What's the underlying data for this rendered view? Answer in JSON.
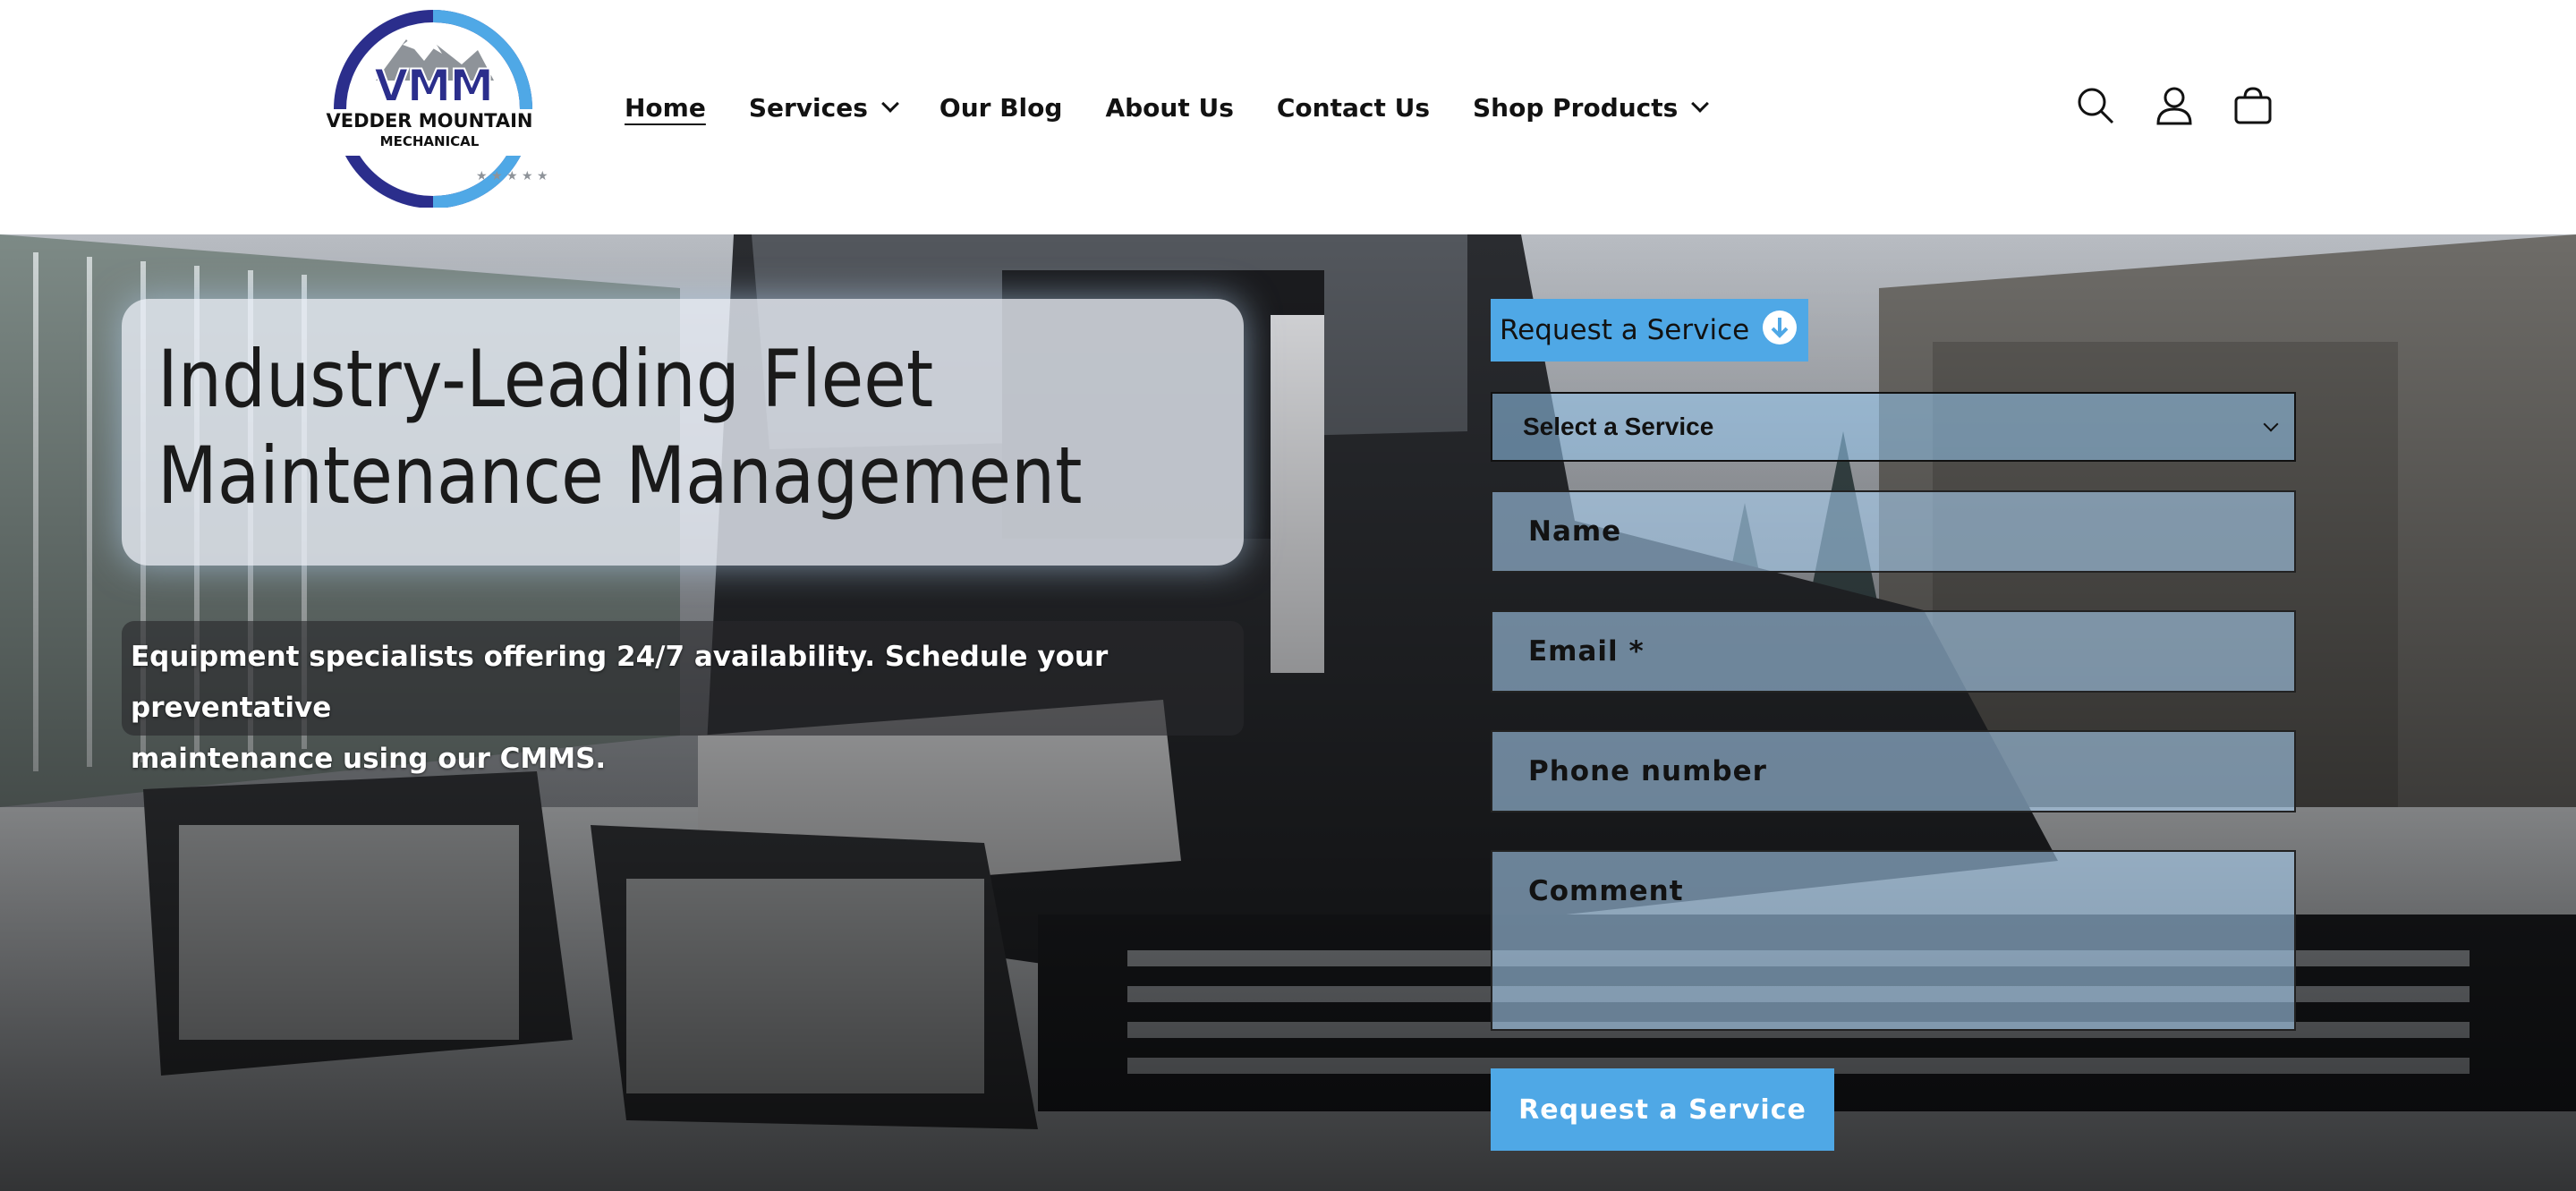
{
  "brand": {
    "logo_line1": "VMM",
    "logo_line2": "VEDDER MOUNTAIN",
    "logo_line3": "MECHANICAL",
    "colors": {
      "primary": "#2a2f8f",
      "accent": "#4fa8e6"
    }
  },
  "nav": {
    "items": [
      {
        "label": "Home",
        "active": true,
        "has_dropdown": false
      },
      {
        "label": "Services",
        "active": false,
        "has_dropdown": true
      },
      {
        "label": "Our Blog",
        "active": false,
        "has_dropdown": false
      },
      {
        "label": "About Us",
        "active": false,
        "has_dropdown": false
      },
      {
        "label": "Contact Us",
        "active": false,
        "has_dropdown": false
      },
      {
        "label": "Shop Products",
        "active": false,
        "has_dropdown": true
      }
    ]
  },
  "header_icons": [
    "search-icon",
    "account-icon",
    "cart-icon"
  ],
  "hero": {
    "title_line1": "Industry-Leading Fleet",
    "title_line2": "Maintenance Management",
    "subtitle_line1": "Equipment specialists offering 24/7 availability. Schedule your preventative",
    "subtitle_line2": "maintenance using our CMMS."
  },
  "form": {
    "heading": "Request a Service",
    "heading_icon": "download-arrow-icon",
    "select_value": "Select a Service",
    "name_placeholder": "Name",
    "email_placeholder": "Email *",
    "phone_placeholder": "Phone number",
    "comment_placeholder": "Comment",
    "submit_label": "Request a Service"
  }
}
